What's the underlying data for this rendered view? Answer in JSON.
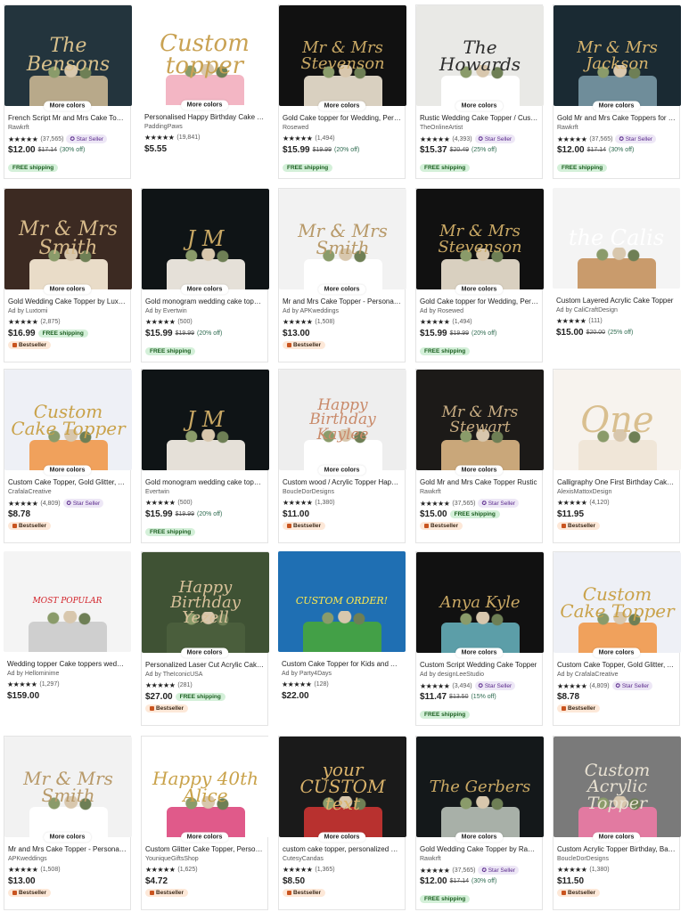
{
  "cards": [
    {
      "img_text": "The Bensons",
      "img_bg": "#23343d",
      "img_fg": "#d8c08c",
      "img_size": "22px",
      "cake": "#b8a98a",
      "more": "More colors",
      "title": "French Script Mr and Mrs Cake Topper",
      "shop": "Rawkrft",
      "count": "(37,565)",
      "star_seller": "Star Seller",
      "price": "$12.00",
      "old": "$17.14",
      "off": "(30% off)",
      "free": "FREE shipping",
      "bestseller": ""
    },
    {
      "img_text": "Custom topper",
      "img_bg": "#ffffff",
      "img_fg": "#c9a253",
      "img_size": "26px",
      "cake": "#f3b6c4",
      "more": "More colors",
      "title": "Personalised Happy Birthday Cake Topper",
      "shop": "PaddingPaws",
      "count": "(19,841)",
      "star_seller": "",
      "price": "$5.55",
      "old": "",
      "off": "",
      "free": "",
      "bestseller": ""
    },
    {
      "img_text": "Mr & Mrs Stevenson",
      "img_bg": "#111111",
      "img_fg": "#c9a864",
      "img_size": "18px",
      "cake": "#d9d0c0",
      "more": "More colors",
      "title": "Gold Cake topper for Wedding, Personalized",
      "shop": "Rosewed",
      "count": "(1,494)",
      "star_seller": "",
      "price": "$15.99",
      "old": "$19.99",
      "off": "(20% off)",
      "free": "FREE shipping",
      "bestseller": ""
    },
    {
      "img_text": "The Howards",
      "img_bg": "#e9e9e6",
      "img_fg": "#2b2b2b",
      "img_size": "20px",
      "cake": "#ffffff",
      "more": "More colors",
      "title": "Rustic Wedding Cake Topper / Custom",
      "shop": "TheOnlineArtist",
      "count": "(4,393)",
      "star_seller": "Star Seller",
      "price": "$15.37",
      "old": "$20.49",
      "off": "(25% off)",
      "free": "FREE shipping",
      "bestseller": ""
    },
    {
      "img_text": "Mr & Mrs Jackson",
      "img_bg": "#1a2a33",
      "img_fg": "#d7b46d",
      "img_size": "18px",
      "cake": "#6f8d9a",
      "more": "More colors",
      "title": "Gold Mr and Mrs Cake Toppers for Wedding",
      "shop": "Rawkrft",
      "count": "(37,565)",
      "star_seller": "Star Seller",
      "price": "$12.00",
      "old": "$17.14",
      "off": "(30% off)",
      "free": "FREE shipping",
      "bestseller": ""
    },
    {
      "img_text": "Mr & Mrs Smith",
      "img_bg": "#3c2a22",
      "img_fg": "#d6b98a",
      "img_size": "22px",
      "cake": "#e9dcc8",
      "more": "More colors",
      "title": "Gold Wedding Cake Topper by Luxtomi",
      "shop": "Ad by Luxtomi",
      "count": "(2,875)",
      "star_seller": "",
      "price": "$16.99",
      "old": "",
      "off": "",
      "free": "FREE shipping",
      "bestseller": "Bestseller"
    },
    {
      "img_text": "J M",
      "img_bg": "#0f1416",
      "img_fg": "#c9a864",
      "img_size": "24px",
      "cake": "#e5e0d8",
      "more": "More colors",
      "title": "Gold monogram wedding cake topper",
      "shop": "Ad by Evertwin",
      "count": "(500)",
      "star_seller": "",
      "price": "$15.99",
      "old": "$19.99",
      "off": "(20% off)",
      "free": "FREE shipping",
      "bestseller": ""
    },
    {
      "img_text": "Mr & Mrs Smith",
      "img_bg": "#f2f2f2",
      "img_fg": "#b89a6a",
      "img_size": "20px",
      "cake": "#ffffff",
      "more": "More colors",
      "title": "Mr and Mrs Cake Topper - Personalized",
      "shop": "Ad by APKweddings",
      "count": "(1,508)",
      "star_seller": "",
      "price": "$13.00",
      "old": "",
      "off": "",
      "free": "",
      "bestseller": "Bestseller"
    },
    {
      "img_text": "Mr & Mrs Stevenson",
      "img_bg": "#111111",
      "img_fg": "#c9a864",
      "img_size": "18px",
      "cake": "#d9d0c0",
      "more": "More colors",
      "title": "Gold Cake topper for Wedding, Personalized",
      "shop": "Ad by Rosewed",
      "count": "(1,494)",
      "star_seller": "",
      "price": "$15.99",
      "old": "$19.99",
      "off": "(20% off)",
      "free": "FREE shipping",
      "bestseller": ""
    },
    {
      "img_text": "the Calis",
      "img_bg": "#f4f4f4",
      "img_fg": "#ffffff",
      "img_size": "24px",
      "cake": "#c99b6c",
      "more": "",
      "title": "Custom Layered Acrylic Cake Topper",
      "shop": "Ad by CaliCraftDesign",
      "count": "(111)",
      "star_seller": "",
      "price": "$15.00",
      "old": "$20.00",
      "off": "(25% off)",
      "free": "",
      "bestseller": ""
    },
    {
      "img_text": "Custom Cake Topper",
      "img_bg": "#eef0f6",
      "img_fg": "#c9a24a",
      "img_size": "20px",
      "cake": "#f0a15c",
      "more": "More colors",
      "title": "Custom Cake Topper, Gold Glitter, Acrylic",
      "shop": "CrafalaCreative",
      "count": "(4,809)",
      "star_seller": "Star Seller",
      "price": "$8.78",
      "old": "",
      "off": "",
      "free": "",
      "bestseller": "Bestseller"
    },
    {
      "img_text": "J M",
      "img_bg": "#0f1416",
      "img_fg": "#c9a864",
      "img_size": "24px",
      "cake": "#e5e0d8",
      "more": "",
      "title": "Gold monogram wedding cake topper",
      "shop": "Evertwin",
      "count": "(500)",
      "star_seller": "",
      "price": "$15.99",
      "old": "$19.99",
      "off": "(20% off)",
      "free": "FREE shipping",
      "bestseller": ""
    },
    {
      "img_text": "Happy Birthday Kaylee",
      "img_bg": "#eeeeee",
      "img_fg": "#c98a6a",
      "img_size": "17px",
      "cake": "#ffffff",
      "more": "More colors",
      "title": "Custom wood / Acrylic Topper Happy Birthday",
      "shop": "BoucleDorDesigns",
      "count": "(1,380)",
      "star_seller": "",
      "price": "$11.00",
      "old": "",
      "off": "",
      "free": "",
      "bestseller": "Bestseller"
    },
    {
      "img_text": "Mr & Mrs Stewart",
      "img_bg": "#1c1a18",
      "img_fg": "#c8ad83",
      "img_size": "17px",
      "cake": "#c9a77a",
      "more": "More colors",
      "title": "Gold Mr and Mrs Cake Topper Rustic",
      "shop": "Rawkrft",
      "count": "(37,565)",
      "star_seller": "Star Seller",
      "price": "$15.00",
      "old": "",
      "off": "",
      "free": "FREE shipping",
      "bestseller": "Bestseller"
    },
    {
      "img_text": "One",
      "img_bg": "#f7f3ee",
      "img_fg": "#d9bf8f",
      "img_size": "40px",
      "cake": "#f0e6d8",
      "more": "",
      "title": "Calligraphy One First Birthday Cake Topper",
      "shop": "AlexisMattoxDesign",
      "count": "(4,120)",
      "star_seller": "",
      "price": "$11.95",
      "old": "",
      "off": "",
      "free": "",
      "bestseller": "Bestseller"
    },
    {
      "img_text": "MOST POPULAR",
      "img_bg": "#f4f4f4",
      "img_fg": "#d21f26",
      "img_size": "9px",
      "cake": "#cfcfcf",
      "more": "",
      "title": "Wedding topper Cake toppers wedding",
      "shop": "Ad by Hellominime",
      "count": "(1,297)",
      "star_seller": "",
      "price": "$159.00",
      "old": "",
      "off": "",
      "free": "",
      "bestseller": ""
    },
    {
      "img_text": "Happy Birthday Yezell",
      "img_bg": "#3f5234",
      "img_fg": "#d8c19a",
      "img_size": "18px",
      "cake": "#4a5e3c",
      "more": "More colors",
      "title": "Personalized Laser Cut Acrylic Cake Topper",
      "shop": "Ad by TheIconicUSA",
      "count": "(281)",
      "star_seller": "",
      "price": "$27.00",
      "old": "",
      "off": "",
      "free": "FREE shipping",
      "bestseller": "Bestseller"
    },
    {
      "img_text": "CUSTOM ORDER!",
      "img_bg": "#1f6fb3",
      "img_fg": "#ffe94d",
      "img_size": "11px",
      "cake": "#43a047",
      "more": "",
      "title": "Custom Cake Topper for Kids and Adults",
      "shop": "Ad by Party4Days",
      "count": "(128)",
      "star_seller": "",
      "price": "$22.00",
      "old": "",
      "off": "",
      "free": "",
      "bestseller": ""
    },
    {
      "img_text": "Anya Kyle",
      "img_bg": "#111111",
      "img_fg": "#c9a864",
      "img_size": "18px",
      "cake": "#5c9ea8",
      "more": "More colors",
      "title": "Custom Script Wedding Cake Topper",
      "shop": "Ad by designLeeStudio",
      "count": "(3,494)",
      "star_seller": "Star Seller",
      "price": "$11.47",
      "old": "$13.50",
      "off": "(15% off)",
      "free": "FREE shipping",
      "bestseller": ""
    },
    {
      "img_text": "Custom Cake Topper",
      "img_bg": "#eef0f6",
      "img_fg": "#c9a24a",
      "img_size": "20px",
      "cake": "#f0a15c",
      "more": "More colors",
      "title": "Custom Cake Topper, Gold Glitter, Acrylic",
      "shop": "Ad by CrafalaCreative",
      "count": "(4,809)",
      "star_seller": "Star Seller",
      "price": "$8.78",
      "old": "",
      "off": "",
      "free": "",
      "bestseller": "Bestseller"
    },
    {
      "img_text": "Mr & Mrs Smith",
      "img_bg": "#f2f2f2",
      "img_fg": "#b89a6a",
      "img_size": "20px",
      "cake": "#ffffff",
      "more": "More colors",
      "title": "Mr and Mrs Cake Topper - Personalized",
      "shop": "APKweddings",
      "count": "(1,508)",
      "star_seller": "",
      "price": "$13.00",
      "old": "",
      "off": "",
      "free": "",
      "bestseller": "Bestseller"
    },
    {
      "img_text": "Happy 40th Alice",
      "img_bg": "#ffffff",
      "img_fg": "#c9a24a",
      "img_size": "20px",
      "cake": "#e05a8a",
      "more": "More colors",
      "title": "Custom Glitter Cake Topper, Personalized",
      "shop": "YouniqueGiftsShop",
      "count": "(1,625)",
      "star_seller": "",
      "price": "$4.72",
      "old": "",
      "off": "",
      "free": "",
      "bestseller": "Bestseller"
    },
    {
      "img_text": "your CUSTOM text",
      "img_bg": "#1a1a1a",
      "img_fg": "#d9b26a",
      "img_size": "20px",
      "cake": "#b8312f",
      "more": "More colors",
      "title": "custom cake topper, personalized cake topper",
      "shop": "CutesyCandas",
      "count": "(1,365)",
      "star_seller": "",
      "price": "$8.50",
      "old": "",
      "off": "",
      "free": "",
      "bestseller": "Bestseller"
    },
    {
      "img_text": "The Gerbers",
      "img_bg": "#14181a",
      "img_fg": "#c9a864",
      "img_size": "18px",
      "cake": "#a8b0a8",
      "more": "More colors",
      "title": "Gold Wedding Cake Topper by Rawkrft",
      "shop": "Rawkrft",
      "count": "(37,565)",
      "star_seller": "Star Seller",
      "price": "$12.00",
      "old": "$17.14",
      "off": "(30% off)",
      "free": "FREE shipping",
      "bestseller": ""
    },
    {
      "img_text": "Custom Acrylic Topper",
      "img_bg": "#7a7a7a",
      "img_fg": "#e8e1d2",
      "img_size": "19px",
      "cake": "#e27aa1",
      "more": "More colors",
      "title": "Custom Acrylic Topper Birthday, Bachelorette",
      "shop": "BoucleDorDesigns",
      "count": "(1,380)",
      "star_seller": "",
      "price": "$11.50",
      "old": "",
      "off": "",
      "free": "",
      "bestseller": "Bestseller"
    }
  ],
  "stars": "★★★★★"
}
